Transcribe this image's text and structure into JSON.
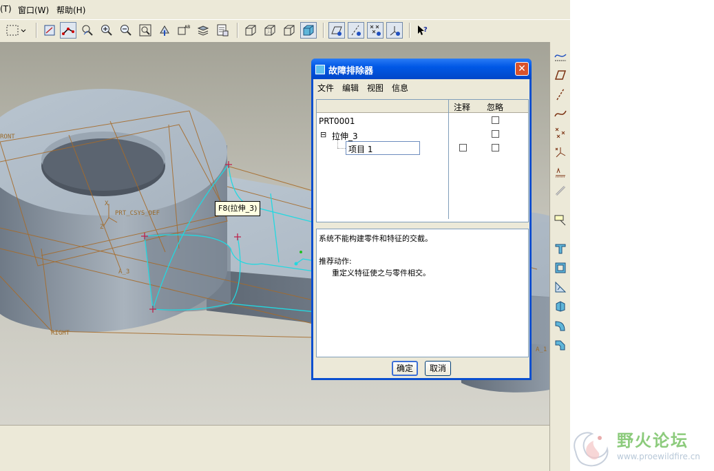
{
  "menubar": {
    "items": [
      "(T)",
      "窗口(W)",
      "帮助(H)"
    ]
  },
  "toolbar": {
    "icons": [
      "select-box-icon",
      "sketch-view-icon",
      "datum-display-icon",
      "datum-axis-icon",
      "zoom-in-icon",
      "zoom-out-icon",
      "refit-icon",
      "reorient-icon",
      "saved-views-icon",
      "layers-icon",
      "model-tree-icon",
      "wireframe-icon",
      "hidden-line-icon",
      "no-hidden-icon",
      "shaded-icon",
      "plane-display-icon",
      "axis-display-icon",
      "point-display-icon",
      "csys-display-icon",
      "context-help-icon"
    ]
  },
  "viewport": {
    "datum_labels": {
      "front": "RONT",
      "csys": "PRT_CSYS_DEF",
      "axis": "A_3",
      "right": "RIGHT",
      "axis2": "A_1",
      "x": "X",
      "z": "Z"
    },
    "tooltip": "F8(拉伸_3)"
  },
  "dialog": {
    "title": "故障排除器",
    "close": "✕",
    "menus": [
      "文件",
      "编辑",
      "视图",
      "信息"
    ],
    "columns": {
      "annotation": "注释",
      "ignore": "忽略"
    },
    "tree": {
      "root": "PRT0001",
      "feature": "拉伸_3",
      "item": "项目 1",
      "expander": "⊟"
    },
    "message": {
      "line1": "系统不能构建零件和特征的交截。",
      "heading": "推荐动作:",
      "line2": "重定义特征使之与零件相交。"
    },
    "buttons": {
      "ok": "确定",
      "cancel": "取消"
    }
  },
  "watermark": {
    "name": "野火论坛",
    "url": "www.proewildfire.cn"
  },
  "colors": {
    "accent": "#0058e6",
    "selection": "#00d8d8",
    "datum": "#9a6a2a",
    "part": "#b5c1cc"
  }
}
